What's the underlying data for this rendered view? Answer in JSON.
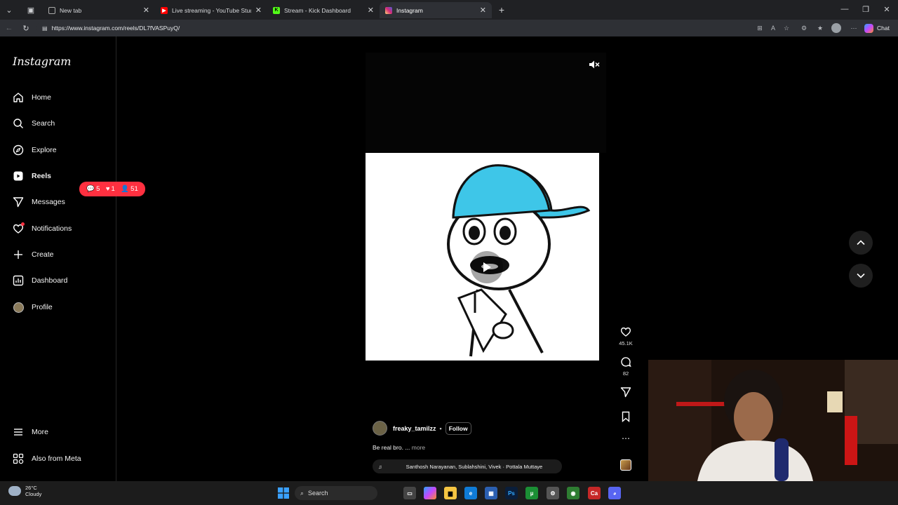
{
  "browser": {
    "tabs": [
      {
        "title": "New tab"
      },
      {
        "title": "Live streaming - YouTube Studio"
      },
      {
        "title": "Stream - Kick Dashboard"
      },
      {
        "title": "Instagram"
      }
    ],
    "url": "https://www.instagram.com/reels/DL7fVASPuyQ/",
    "chat_label": "Chat"
  },
  "sidebar": {
    "logo": "Instagram",
    "items": [
      {
        "label": "Home",
        "icon": "home-icon"
      },
      {
        "label": "Search",
        "icon": "search-icon"
      },
      {
        "label": "Explore",
        "icon": "compass-icon"
      },
      {
        "label": "Reels",
        "icon": "reels-icon"
      },
      {
        "label": "Messages",
        "icon": "send-icon"
      },
      {
        "label": "Notifications",
        "icon": "heart-icon"
      },
      {
        "label": "Create",
        "icon": "plus-icon"
      },
      {
        "label": "Dashboard",
        "icon": "chart-icon"
      },
      {
        "label": "Profile",
        "icon": "avatar-icon"
      }
    ],
    "more_label": "More",
    "meta_label": "Also from Meta",
    "notifications": {
      "comments": "5",
      "likes": "1",
      "followers": "51"
    }
  },
  "reel": {
    "likes": "45.1K",
    "comments": "82",
    "author": "freaky_tamilzz",
    "follow_label": "Follow",
    "caption": "Be real bro. ...",
    "more_label": "more",
    "audio": "Santhosh Narayanan, Sublahshini, Vivek · Pottala Muttaye"
  },
  "taskbar": {
    "temp": "26°C",
    "condition": "Cloudy",
    "search_label": "Search"
  },
  "colors": {
    "accent": "#ff3040",
    "background": "#000000"
  }
}
